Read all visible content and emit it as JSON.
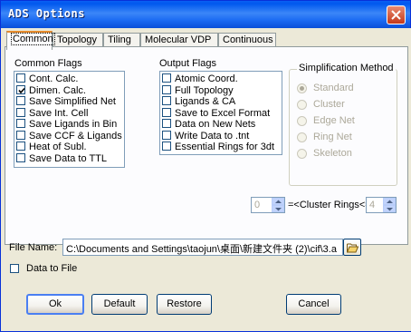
{
  "window": {
    "title": "ADS Options"
  },
  "tabs": [
    {
      "label": "Common"
    },
    {
      "label": "Topology"
    },
    {
      "label": "Tiling"
    },
    {
      "label": "Molecular VDP"
    },
    {
      "label": "Continuous"
    }
  ],
  "common_flags": {
    "label": "Common Flags",
    "items": [
      {
        "label": "Cont. Calc.",
        "checked": false
      },
      {
        "label": "Dimen. Calc.",
        "checked": true
      },
      {
        "label": "Save Simplified Net",
        "checked": false
      },
      {
        "label": "Save Int. Cell",
        "checked": false
      },
      {
        "label": "Save Ligands in Bin",
        "checked": false
      },
      {
        "label": "Save CCF & Ligands",
        "checked": false
      },
      {
        "label": "Heat of Subl.",
        "checked": false
      },
      {
        "label": "Save Data to TTL",
        "checked": false
      }
    ]
  },
  "output_flags": {
    "label": "Output Flags",
    "items": [
      {
        "label": "Atomic Coord.",
        "checked": false
      },
      {
        "label": "Full Topology",
        "checked": false
      },
      {
        "label": "Ligands & CA",
        "checked": false
      },
      {
        "label": "Save to Excel Format",
        "checked": false
      },
      {
        "label": "Data on New Nets",
        "checked": false
      },
      {
        "label": "Write Data to .tnt",
        "checked": false
      },
      {
        "label": "Essential Rings for 3dt",
        "checked": false
      }
    ]
  },
  "simplification": {
    "label": "Simplification Method",
    "options": [
      {
        "label": "Standard",
        "selected": true
      },
      {
        "label": "Cluster",
        "selected": false
      },
      {
        "label": "Edge Net",
        "selected": false
      },
      {
        "label": "Ring Net",
        "selected": false
      },
      {
        "label": "Skeleton",
        "selected": false
      }
    ]
  },
  "cluster_rings": {
    "min": "0",
    "label": "=<Cluster Rings<=",
    "max": "4"
  },
  "file": {
    "label": "File Name:",
    "value": "C:\\Documents and Settings\\taojun\\桌面\\新建文件夹 (2)\\cif\\3.a"
  },
  "data_to_file": {
    "label": "Data to File",
    "checked": false
  },
  "buttons": {
    "ok": "Ok",
    "default": "Default",
    "restore": "Restore",
    "cancel": "Cancel"
  }
}
